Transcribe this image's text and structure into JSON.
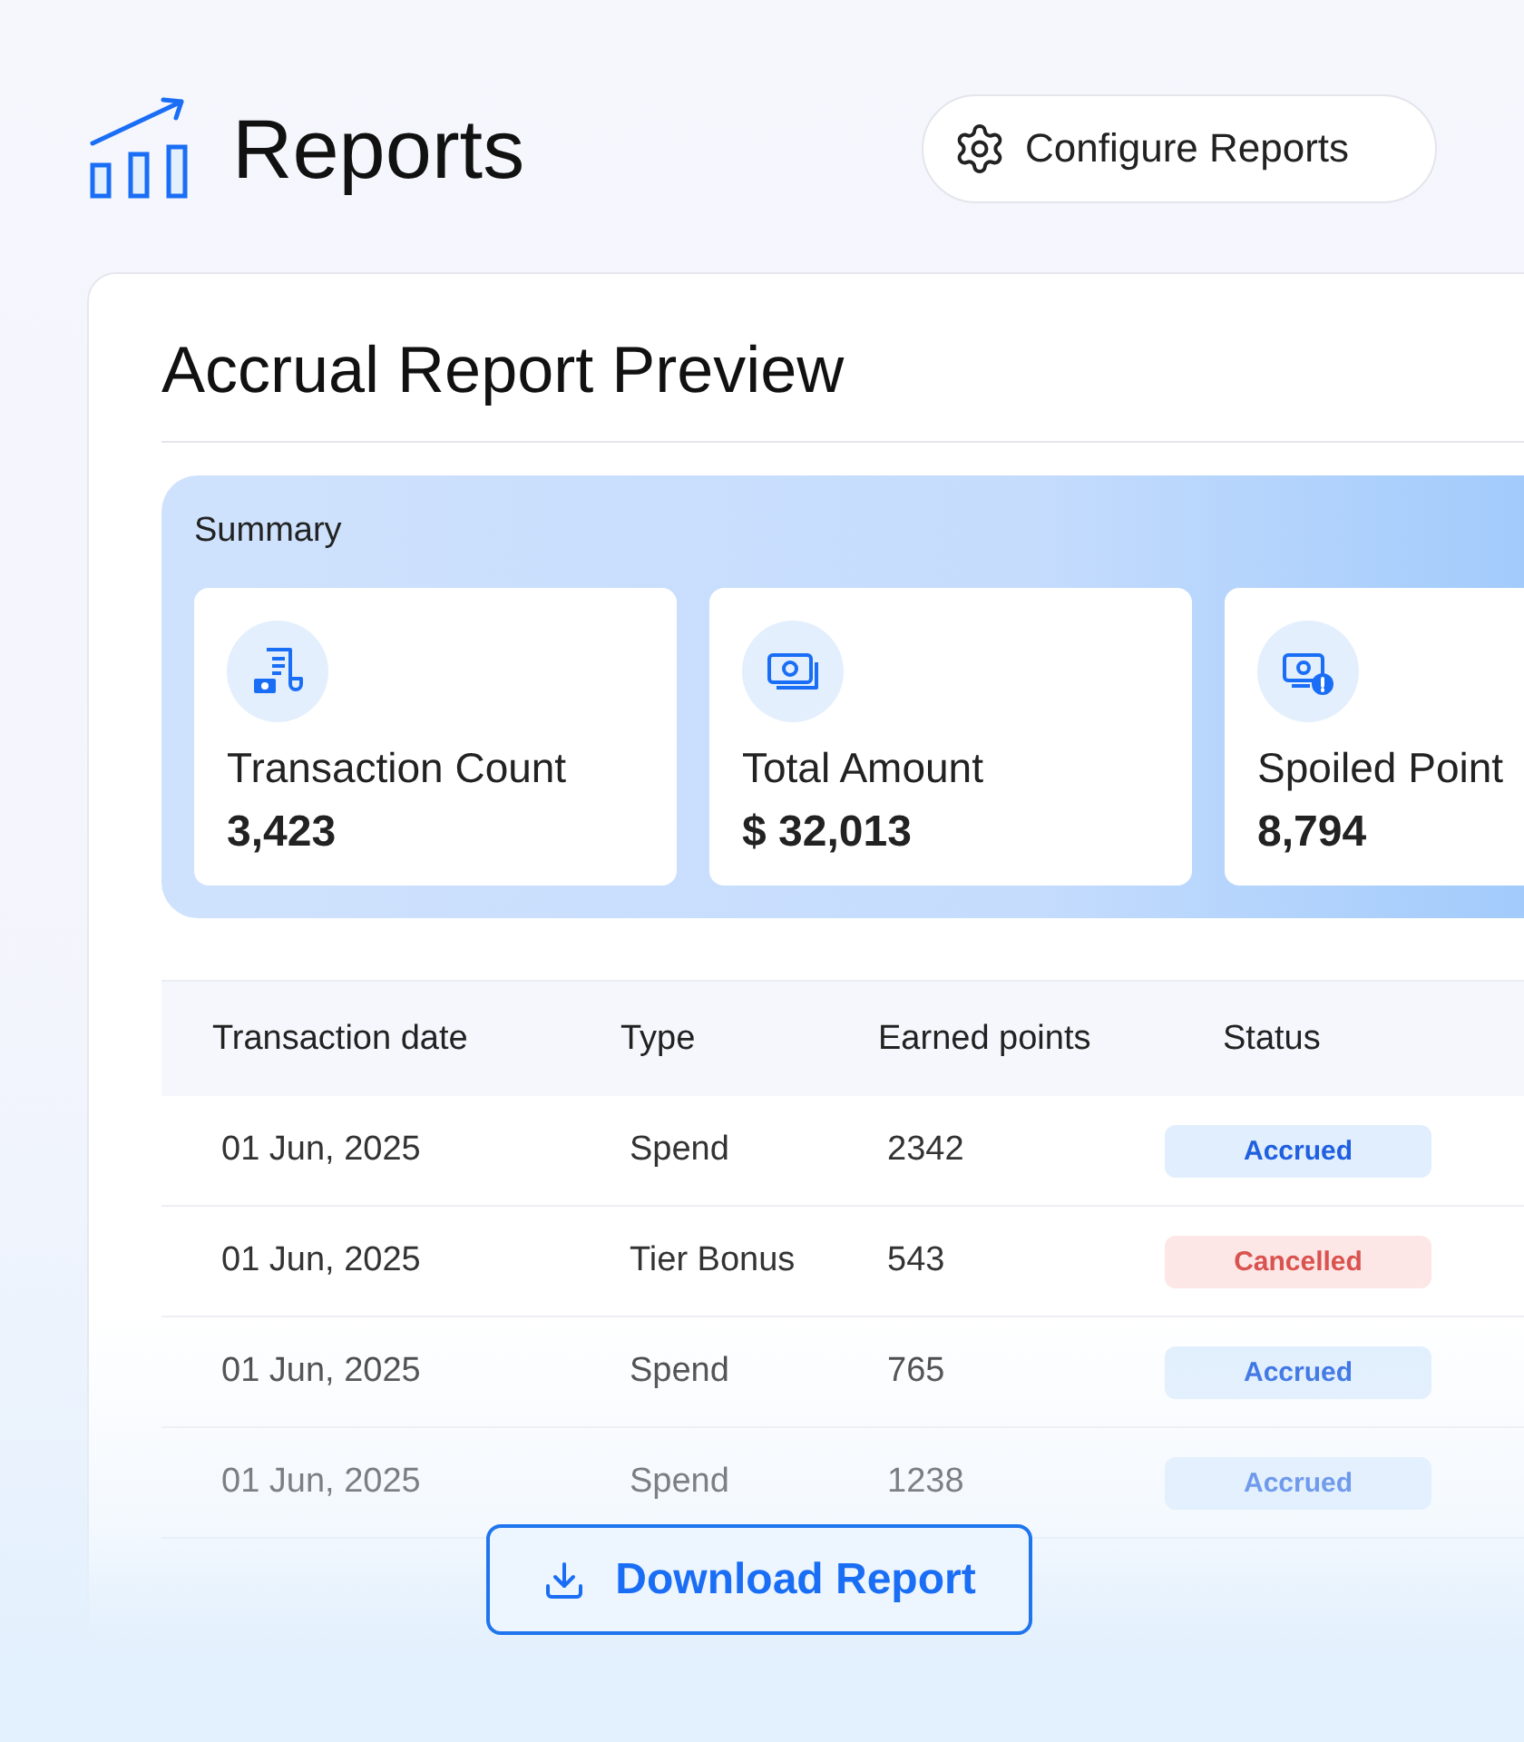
{
  "header": {
    "title": "Reports",
    "configure_button": "Configure Reports"
  },
  "preview": {
    "title": "Accrual Report Preview",
    "summary": {
      "label": "Summary",
      "cards": [
        {
          "kind": "receipt",
          "label": "Transaction Count",
          "value": "3,423"
        },
        {
          "kind": "money",
          "label": "Total Amount",
          "value": "$ 32,013"
        },
        {
          "kind": "money_alert",
          "label": "Spoiled Point",
          "value": "8,794"
        }
      ]
    },
    "table": {
      "columns": [
        "Transaction date",
        "Type",
        "Earned points",
        "Status"
      ],
      "rows": [
        {
          "date": "01 Jun, 2025",
          "type": "Spend",
          "points": "2342",
          "status": "Accrued",
          "kind": "accrued"
        },
        {
          "date": "01 Jun, 2025",
          "type": "Tier Bonus",
          "points": "543",
          "status": "Cancelled",
          "kind": "cancelled"
        },
        {
          "date": "01 Jun, 2025",
          "type": "Spend",
          "points": "765",
          "status": "Accrued",
          "kind": "accrued"
        },
        {
          "date": "01 Jun, 2025",
          "type": "Spend",
          "points": "1238",
          "status": "Accrued",
          "kind": "accrued"
        }
      ]
    }
  },
  "download_button": "Download Report"
}
